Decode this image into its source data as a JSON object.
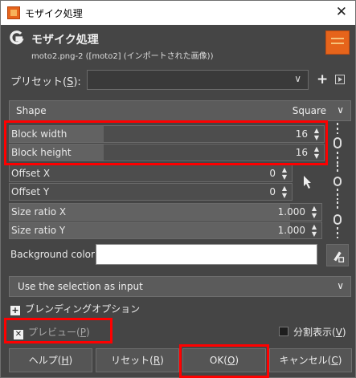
{
  "window": {
    "title": "モザイク処理",
    "close_glyph": "✕"
  },
  "header": {
    "title": "モザイク処理",
    "subtitle": "moto2.png-2 ([moto2] (インポートされた画像))",
    "icon": "gimp-icon"
  },
  "presets": {
    "label": "プリセット",
    "mnemonic": "S",
    "value": "",
    "add_glyph": "+"
  },
  "shape": {
    "label": "Shape",
    "value": "Square"
  },
  "fields": {
    "block_width": {
      "label": "Block width",
      "value": "16"
    },
    "block_height": {
      "label": "Block height",
      "value": "16"
    },
    "offset_x": {
      "label": "Offset X",
      "value": "0"
    },
    "offset_y": {
      "label": "Offset Y",
      "value": "0"
    },
    "size_ratio_x": {
      "label": "Size ratio X",
      "value": "1.000"
    },
    "size_ratio_y": {
      "label": "Size ratio Y",
      "value": "1.000"
    }
  },
  "background": {
    "label": "Background color",
    "color": "#ffffff"
  },
  "input_mode": {
    "value": "Use the selection as input"
  },
  "blending": {
    "label": "ブレンディングオプション"
  },
  "preview": {
    "label": "プレビュー",
    "mnemonic": "P",
    "checked": true
  },
  "split_view": {
    "label": "分割表示",
    "mnemonic": "V",
    "checked": false
  },
  "buttons": {
    "help": {
      "label": "ヘルプ",
      "mnemonic": "H"
    },
    "reset": {
      "label": "リセット",
      "mnemonic": "R"
    },
    "ok": {
      "label": "OK",
      "mnemonic": "O"
    },
    "cancel": {
      "label": "キャンセル",
      "mnemonic": "C"
    }
  },
  "highlight_color": "#ff0000"
}
